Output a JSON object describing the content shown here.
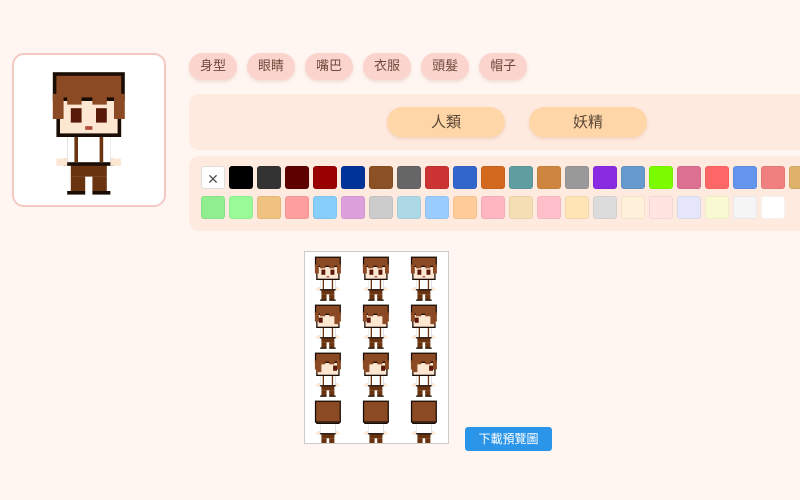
{
  "tabs": [
    "身型",
    "眼睛",
    "嘴巴",
    "衣服",
    "頭髮",
    "帽子"
  ],
  "races": [
    "人類",
    "妖精"
  ],
  "palette": {
    "none_symbol": "✕",
    "row1": [
      "#000000",
      "#333333",
      "#5c0000",
      "#990000",
      "#003399",
      "#8b5125",
      "#666666",
      "#cc3333",
      "#3366cc",
      "#d2691e",
      "#5f9ea0",
      "#cd853f",
      "#999999",
      "#8a2be2",
      "#6699cc",
      "#7cfc00",
      "#db7093",
      "#ff6666",
      "#6495ed",
      "#f08080",
      "#deb26b"
    ],
    "row2": [
      "#90ee90",
      "#98fb98",
      "#f0c27f",
      "#ff9e9e",
      "#87cefa",
      "#dda0dd",
      "#cccccc",
      "#add8e6",
      "#99ccff",
      "#ffcc99",
      "#ffb6c1",
      "#f5deb3",
      "#ffc0cb",
      "#ffe4b5",
      "#dcdcdc",
      "#fff0d9",
      "#ffe4e1",
      "#e6e6fa",
      "#fafad2",
      "#f5f5f5",
      "#ffffff"
    ]
  },
  "download_label": "下載預覽圖",
  "colors": {
    "hair": "#8b4a23",
    "skin": "#fde6d2",
    "shirt": "#ffffff",
    "pants": "#6b3410",
    "outline": "#1a0d05"
  }
}
